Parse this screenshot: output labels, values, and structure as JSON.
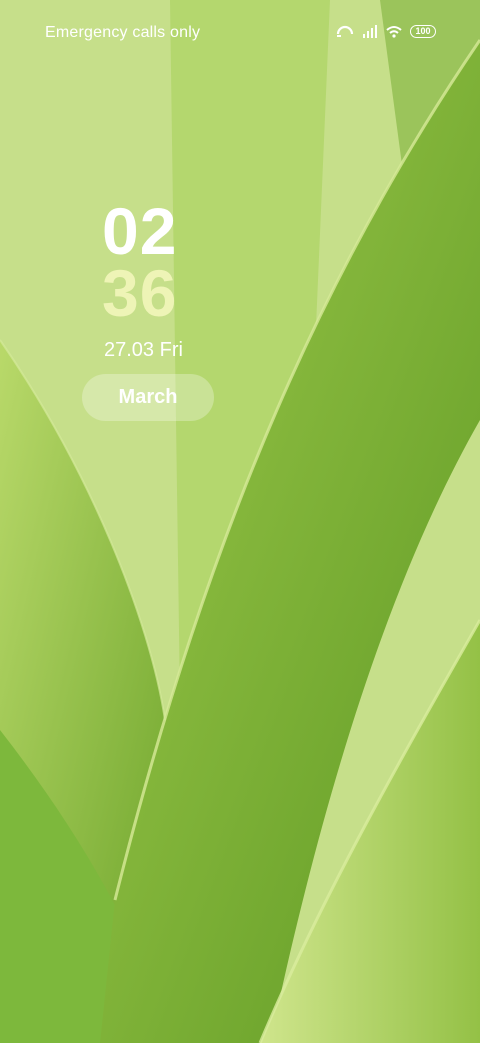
{
  "status_bar": {
    "carrier_text": "Emergency calls only",
    "battery_level": "100",
    "icons": [
      "sync-icon",
      "signal-bars-icon",
      "wifi-icon",
      "battery-icon"
    ]
  },
  "lock_screen": {
    "time_hour": "02",
    "time_minute": "36",
    "date": "27.03 Fri",
    "widget_label": "March"
  },
  "colors": {
    "minute_tint": "#eef4b6",
    "wallpaper_green": "#8cbc3a"
  }
}
